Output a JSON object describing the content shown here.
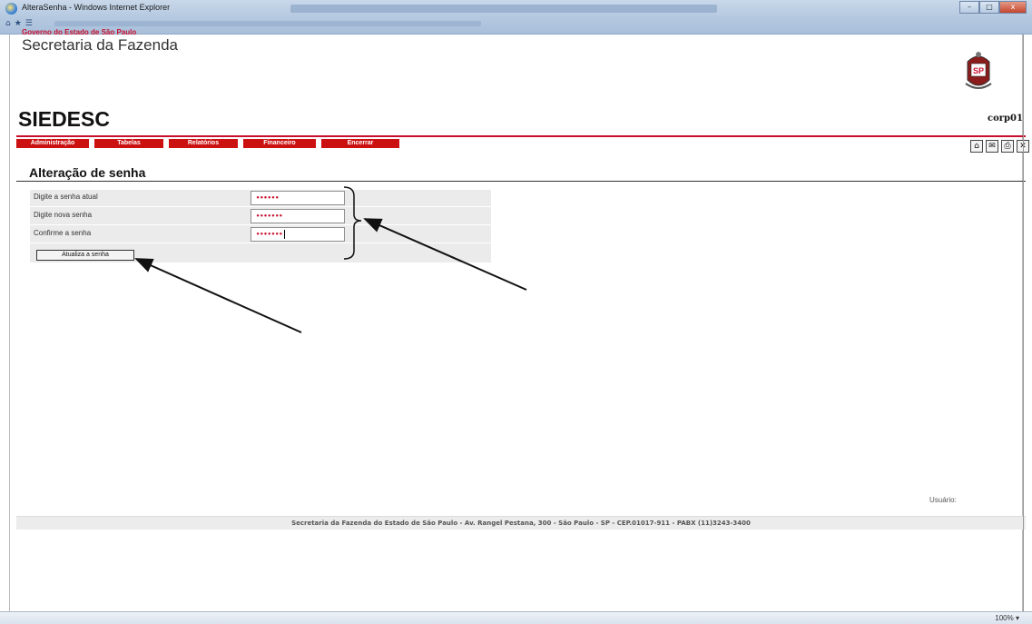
{
  "window": {
    "title": "AlteraSenha - Windows Internet Explorer",
    "controls": [
      "–",
      "□",
      "x"
    ]
  },
  "header": {
    "gov_label": "Governo do Estado de São Paulo",
    "department": "Secretaria da Fazenda",
    "system": "SIEDESC",
    "user_code": "corp01",
    "seal_text": "SP"
  },
  "menu": {
    "items": [
      "Administração",
      "Tabelas",
      "Relatórios",
      "Financeiro",
      "Encerrar"
    ]
  },
  "tools": [
    "home-icon",
    "mail-icon",
    "print-icon",
    "close-icon"
  ],
  "form": {
    "heading": "Alteração de senha",
    "fields": [
      {
        "label": "Digite a senha atual",
        "value": "••••••"
      },
      {
        "label": "Digite nova senha",
        "value": "•••••••"
      },
      {
        "label": "Confirme a senha",
        "value": "•••••••"
      }
    ],
    "submit": "Atualiza a senha"
  },
  "usuario_label": "Usuário:",
  "footer": "Secretaria da Fazenda do Estado de São Paulo - Av. Rangel Pestana, 300 - São Paulo - SP - CEP.01017-911 - PABX (11)3243-3400",
  "statusbar": {
    "zoom": "100%"
  },
  "colors": {
    "accent_red": "#cc1111",
    "panel_gray": "#ebebeb"
  }
}
